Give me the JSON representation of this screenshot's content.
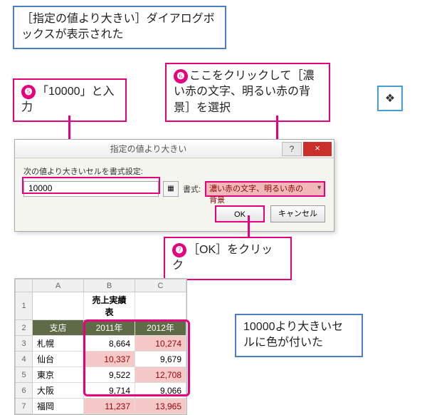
{
  "callouts": {
    "top": "［指定の値より大きい］ダイアログボックスが表示された",
    "result": "10000より大きいセルに色が付いた"
  },
  "steps": {
    "s5_num": "❺",
    "s5_text": "「10000」と入力",
    "s6_num": "❻",
    "s6_text": "ここをクリックして［濃い赤の文字、明るい赤の背景］を選択",
    "s7_num": "❼",
    "s7_text": "［OK］をクリック"
  },
  "dropdown_glyph": "❖",
  "dialog": {
    "title": "指定の値より大きい",
    "help": "?",
    "close": "×",
    "label": "次の値より大きいセルを書式設定:",
    "value": "10000",
    "range_glyph": "▦",
    "fmt_label": "書式:",
    "fmt_value": "濃い赤の文字、明るい赤の背景",
    "ok": "OK",
    "cancel": "キャンセル"
  },
  "sheet": {
    "cols": {
      "A": "A",
      "B": "B",
      "C": "C"
    },
    "title": "売上実績表",
    "headers": {
      "branch": "支店",
      "y1": "2011年",
      "y2": "2012年"
    },
    "rows": [
      {
        "n": "1"
      },
      {
        "n": "2"
      },
      {
        "n": "3",
        "branch": "札幌",
        "y1": "8,664",
        "y2": "10,274",
        "y1hl": false,
        "y2hl": true
      },
      {
        "n": "4",
        "branch": "仙台",
        "y1": "10,337",
        "y2": "9,679",
        "y1hl": true,
        "y2hl": false
      },
      {
        "n": "5",
        "branch": "東京",
        "y1": "9,522",
        "y2": "12,708",
        "y1hl": false,
        "y2hl": true
      },
      {
        "n": "6",
        "branch": "大阪",
        "y1": "9,714",
        "y2": "9,066",
        "y1hl": false,
        "y2hl": false
      },
      {
        "n": "7",
        "branch": "福岡",
        "y1": "11,237",
        "y2": "13,965",
        "y1hl": true,
        "y2hl": true
      }
    ]
  },
  "chart_data": {
    "type": "table",
    "title": "売上実績表",
    "columns": [
      "支店",
      "2011年",
      "2012年"
    ],
    "rows": [
      [
        "札幌",
        8664,
        10274
      ],
      [
        "仙台",
        10337,
        9679
      ],
      [
        "東京",
        9522,
        12708
      ],
      [
        "大阪",
        9714,
        9066
      ],
      [
        "福岡",
        11237,
        13965
      ]
    ],
    "highlight_rule": "> 10000"
  }
}
